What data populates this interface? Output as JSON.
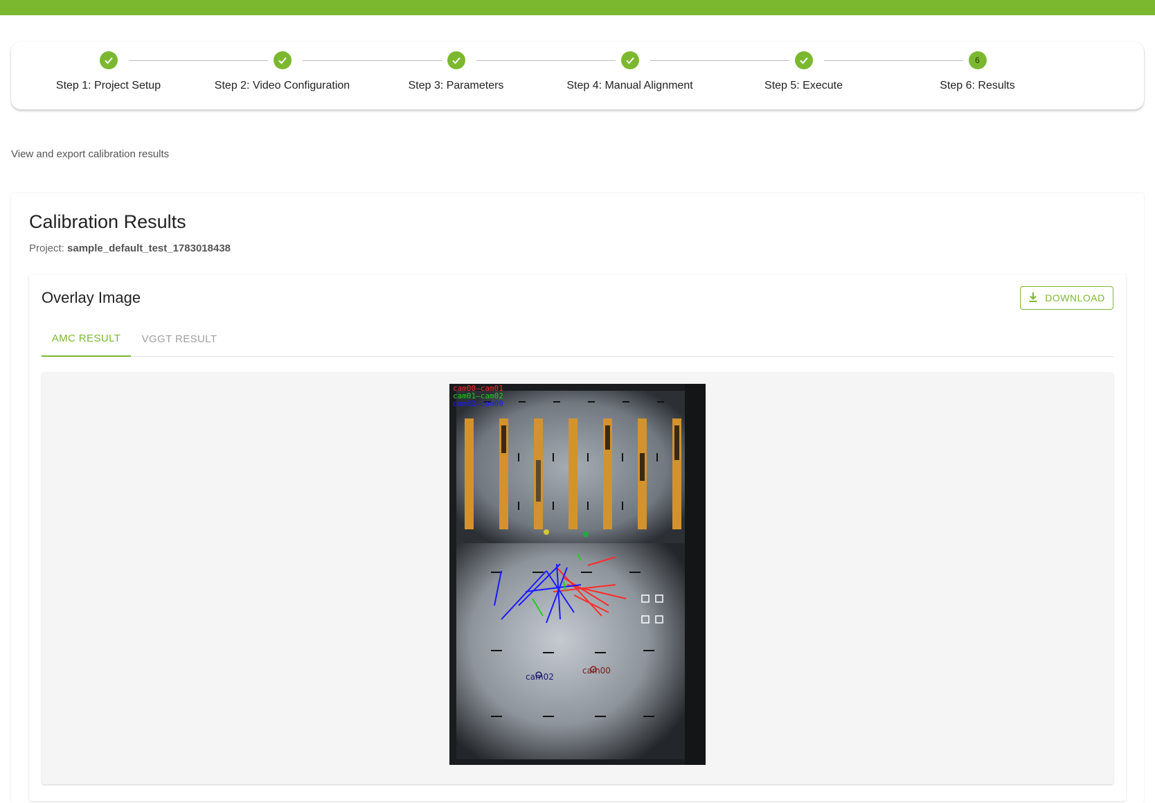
{
  "colors": {
    "brand": "#7cb82f",
    "text_primary": "#212121",
    "text_secondary": "#666666",
    "tab_inactive": "#9e9e9e",
    "series_red": "#ff2a2a",
    "series_green": "#22cc22",
    "series_blue": "#1a1aff"
  },
  "stepper": {
    "steps": [
      {
        "label": "Step 1: Project Setup",
        "status": "completed",
        "icon": "check-icon"
      },
      {
        "label": "Step 2: Video Configuration",
        "status": "completed",
        "icon": "check-icon"
      },
      {
        "label": "Step 3: Parameters",
        "status": "completed",
        "icon": "check-icon"
      },
      {
        "label": "Step 4: Manual Alignment",
        "status": "completed",
        "icon": "check-icon"
      },
      {
        "label": "Step 5: Execute",
        "status": "completed",
        "icon": "check-icon"
      },
      {
        "label": "Step 6: Results",
        "status": "active",
        "number": "6"
      }
    ]
  },
  "page": {
    "subtitle": "View and export calibration results"
  },
  "results": {
    "title": "Calibration Results",
    "project_label": "Project:",
    "project_name": "sample_default_test_1783018438"
  },
  "overlay": {
    "title": "Overlay Image",
    "download_label": "DOWNLOAD",
    "download_icon": "download-icon",
    "tabs": [
      {
        "label": "AMC RESULT",
        "active": true
      },
      {
        "label": "VGGT RESULT",
        "active": false
      }
    ],
    "image": {
      "legend": [
        "cam00—cam01",
        "cam01—cam02",
        "cam02—cam00"
      ],
      "camera_labels": [
        "cam02",
        "cam00"
      ]
    }
  }
}
